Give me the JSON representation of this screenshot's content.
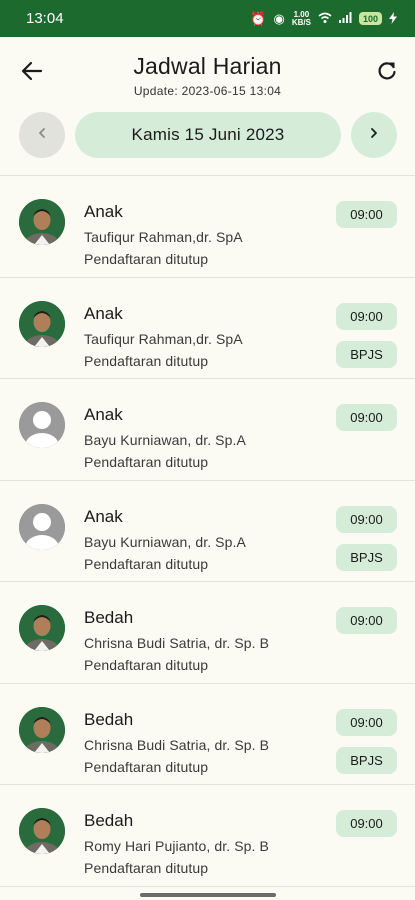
{
  "status_bar": {
    "time": "13:04",
    "speed": "1.00\nKB/S",
    "battery": "100",
    "icons": [
      "alarm-icon",
      "hotspot-icon",
      "data-speed-icon",
      "wifi-icon",
      "signal-icon",
      "battery-icon",
      "charging-icon"
    ]
  },
  "header": {
    "title": "Jadwal Harian",
    "subtitle": "Update: 2023-06-15 13:04",
    "back_icon": "back-arrow-icon",
    "refresh_icon": "refresh-icon"
  },
  "date_nav": {
    "date_label": "Kamis 15 Juni 2023",
    "prev_icon": "chevron-left-icon",
    "next_icon": "chevron-right-icon"
  },
  "colors": {
    "primary": "#1d6a2f",
    "chip_bg": "#d5ecd9",
    "background": "#fbfbf3"
  },
  "schedules": [
    {
      "specialty": "Anak",
      "doctor": "Taufiqur Rahman,dr. SpA",
      "status": "Pendaftaran ditutup",
      "time": "09:00",
      "badge": "",
      "avatar": "photo"
    },
    {
      "specialty": "Anak",
      "doctor": "Taufiqur Rahman,dr. SpA",
      "status": "Pendaftaran ditutup",
      "time": "09:00",
      "badge": "BPJS",
      "avatar": "photo"
    },
    {
      "specialty": "Anak",
      "doctor": "Bayu Kurniawan, dr. Sp.A",
      "status": "Pendaftaran ditutup",
      "time": "09:00",
      "badge": "",
      "avatar": "placeholder"
    },
    {
      "specialty": "Anak",
      "doctor": "Bayu Kurniawan, dr. Sp.A",
      "status": "Pendaftaran ditutup",
      "time": "09:00",
      "badge": "BPJS",
      "avatar": "placeholder"
    },
    {
      "specialty": "Bedah",
      "doctor": "Chrisna Budi Satria, dr. Sp. B",
      "status": "Pendaftaran ditutup",
      "time": "09:00",
      "badge": "",
      "avatar": "photo"
    },
    {
      "specialty": "Bedah",
      "doctor": "Chrisna Budi Satria, dr. Sp. B",
      "status": "Pendaftaran ditutup",
      "time": "09:00",
      "badge": "BPJS",
      "avatar": "photo"
    },
    {
      "specialty": "Bedah",
      "doctor": "Romy Hari Pujianto, dr. Sp. B",
      "status": "Pendaftaran ditutup",
      "time": "09:00",
      "badge": "",
      "avatar": "photo"
    }
  ]
}
